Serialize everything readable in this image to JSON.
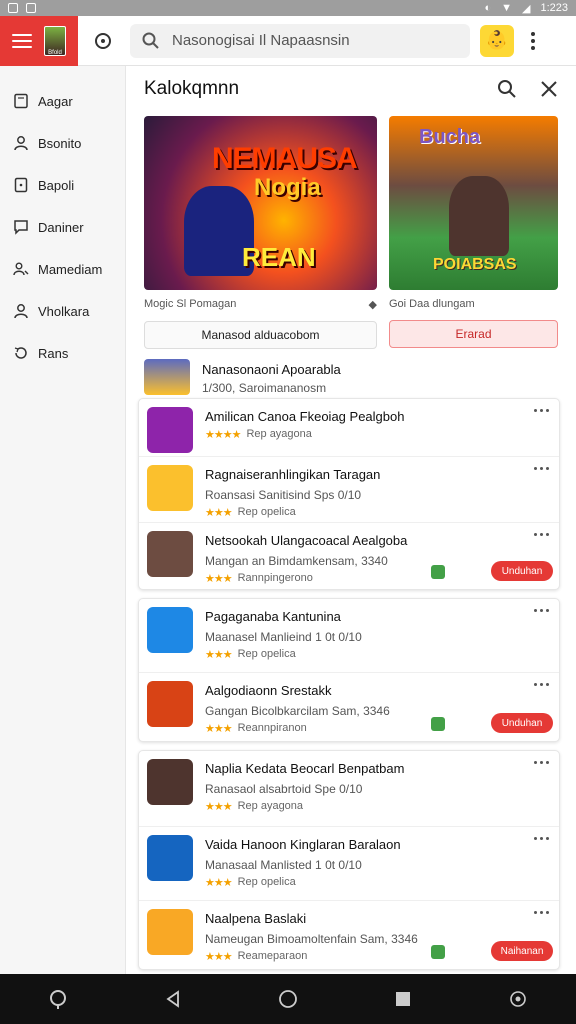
{
  "status_bar": {
    "time": "1:223",
    "left_icons": [
      "notification-icon",
      "settings-icon"
    ],
    "right_icons": [
      "sync-icon",
      "wifi-icon",
      "signal-icon"
    ]
  },
  "top_bar": {
    "logo_text": "Bfold",
    "search_text": "Nasonogisai Il Napaasnsin",
    "avatar_emoji": "👶"
  },
  "sidebar": {
    "items": [
      {
        "label": "Aagar",
        "icon": "book-icon"
      },
      {
        "label": "Bsonito",
        "icon": "user-icon"
      },
      {
        "label": "Bapoli",
        "icon": "tablet-icon"
      },
      {
        "label": "Daniner",
        "icon": "chat-icon"
      },
      {
        "label": "Mamediam",
        "icon": "people-icon"
      },
      {
        "label": "Vholkara",
        "icon": "person-icon"
      },
      {
        "label": "Rans",
        "icon": "history-icon"
      }
    ]
  },
  "panel": {
    "title": "Kalokqmnn",
    "featured": [
      {
        "art_line1": "NEMAUSA",
        "art_line2": "Nogia",
        "art_line3": "REAN",
        "caption": "Mogic Sl Pomagan",
        "button": "Manasod alduacobom"
      },
      {
        "art_line1": "Bucha",
        "art_line2": "POIABSAS",
        "caption": "Goi Daa dlungam",
        "button": "Erarad"
      }
    ],
    "plain_item": {
      "title": "Nanasonaoni Apoarabla",
      "subtitle": "1/300, Saroimananosm"
    },
    "cards": [
      {
        "items": [
          {
            "title": "Amilican Canoa Fkeoiag Pealgboh",
            "stars": "★★★★",
            "rating": "Rep ayagona",
            "icon_color": "#8e24aa"
          },
          {
            "title": "Ragnaiseranhlingikan Taragan",
            "sub": "Roansasi Sanitisind Sps 0/10",
            "stars": "★★★",
            "rating": "Rep opelica",
            "icon_color": "#fbc02d"
          },
          {
            "title": "Netsookah Ulangacoacal Aealgoba",
            "sub": "Mangan an Bimdamkensam, 3340",
            "stars": "★★★",
            "rating": "Rannpingerono",
            "cta": "Unduhan",
            "icon_color": "#6d4c41"
          }
        ]
      },
      {
        "items": [
          {
            "title": "Pagaganaba Kantunina",
            "sub": "Maanasel Manlieind 1 0t 0/10",
            "stars": "★★★",
            "rating": "Rep opelica",
            "icon_color": "#1e88e5"
          },
          {
            "title": "Aalgodiaonn Srestakk",
            "sub": "Gangan Bicolbkarcilam Sam, 3346",
            "stars": "★★★",
            "rating": "Reannpiranon",
            "cta": "Unduhan",
            "icon_color": "#d84315"
          }
        ]
      },
      {
        "items": [
          {
            "title": "Naplia Kedata Beocarl Benpatbam",
            "sub": "Ranasaol alsabrtoid Spe 0/10",
            "stars": "★★★",
            "rating": "Rep ayagona",
            "icon_color": "#4e342e"
          },
          {
            "title": "Vaida Hanoon Kinglaran Baralaon",
            "sub": "Manasaal Manlisted 1 0t 0/10",
            "stars": "★★★",
            "rating": "Rep opelica",
            "icon_color": "#1565c0"
          },
          {
            "title": "Naalpena Baslaki",
            "sub": "Nameugan Bimoamoltenfain Sam, 3346",
            "stars": "★★★",
            "rating": "Reameparaon",
            "cta": "Naihanan",
            "icon_color": "#f9a825"
          }
        ]
      }
    ]
  },
  "nav_bar": {
    "icons": [
      "assistant-icon",
      "back-icon",
      "home-icon",
      "recents-icon",
      "settings-icon"
    ]
  }
}
